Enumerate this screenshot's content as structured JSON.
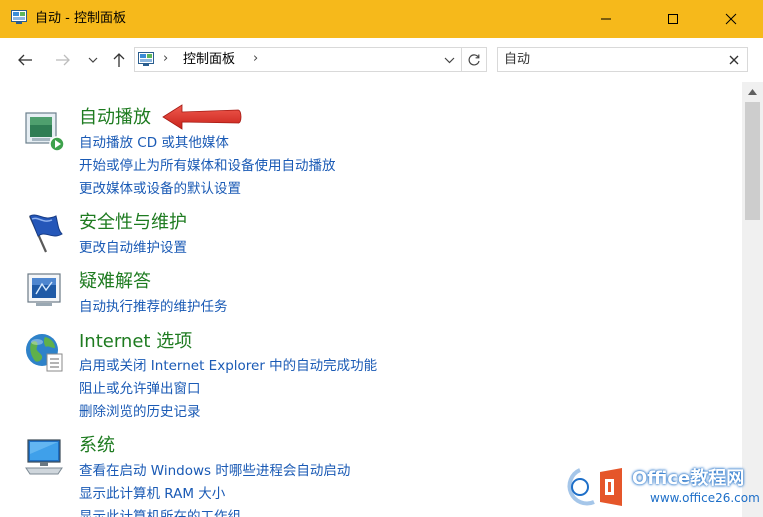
{
  "window": {
    "title": "自动 - 控制面板",
    "buttons": {
      "minimize": "minimize-icon",
      "maximize": "maximize-icon",
      "close": "close-icon"
    }
  },
  "navbar": {
    "breadcrumb": [
      "控制面板"
    ],
    "separator": "›",
    "search_value": "自动"
  },
  "categories": [
    {
      "title": "自动播放",
      "icon": "autoplay-icon",
      "links": [
        "自动播放 CD 或其他媒体",
        "开始或停止为所有媒体和设备使用自动播放",
        "更改媒体或设备的默认设置"
      ]
    },
    {
      "title": "安全性与维护",
      "icon": "security-maintenance-flag-icon",
      "links": [
        "更改自动维护设置"
      ]
    },
    {
      "title": "疑难解答",
      "icon": "troubleshooting-icon",
      "links": [
        "自动执行推荐的维护任务"
      ]
    },
    {
      "title": "Internet 选项",
      "icon": "internet-options-globe-icon",
      "links": [
        "启用或关闭 Internet Explorer 中的自动完成功能",
        "阻止或允许弹出窗口",
        "删除浏览的历史记录"
      ]
    },
    {
      "title": "系统",
      "icon": "system-computer-icon",
      "links": [
        "查看在启动 Windows 时哪些进程会自动启动",
        "显示此计算机 RAM 大小",
        "显示此计算机所在的工作组"
      ]
    }
  ],
  "watermark": {
    "line1": "Office教程网",
    "line2": "www.office26.com"
  },
  "colors": {
    "titlebar": "#f6b91b",
    "category_title": "#1e7b20",
    "link": "#1a5ab5",
    "annotation_arrow": "#e0322b"
  }
}
